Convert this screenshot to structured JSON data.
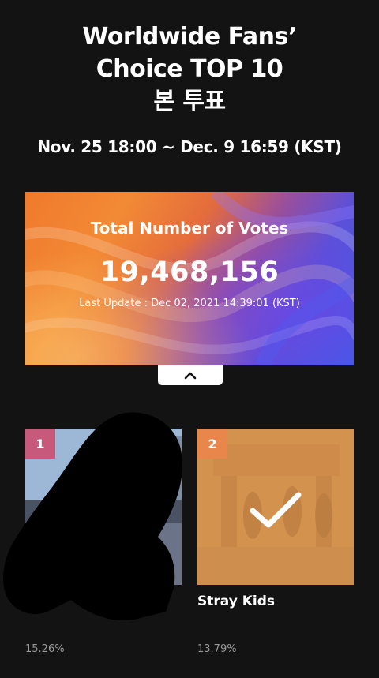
{
  "header": {
    "title_lines": [
      "Worldwide Fans’",
      "Choice TOP 10",
      "본 투표"
    ],
    "period": "Nov. 25 18:00 ~ Dec. 9 16:59 (KST)"
  },
  "banner": {
    "title": "Total Number of Votes",
    "count": "19,468,156",
    "last_update": "Last Update : Dec 02, 2021 14:39:01 (KST)"
  },
  "collapse_icon": "chevron-up-icon",
  "candidates": [
    {
      "rank": "1",
      "name": "",
      "percent": "15.26%",
      "selected": false
    },
    {
      "rank": "2",
      "name": "Stray Kids",
      "percent": "13.79%",
      "selected": true,
      "check_icon": "checkmark-icon"
    }
  ],
  "colors": {
    "background": "#131313",
    "rank1_badge": "#c75a7a",
    "rank2_badge": "#e9864c",
    "selected_overlay": "#d99652",
    "percent_text": "#9a9a9a"
  }
}
